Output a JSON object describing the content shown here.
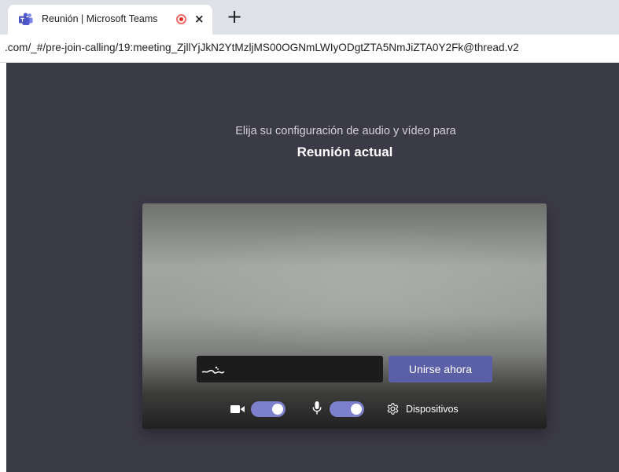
{
  "browser": {
    "tab": {
      "title": "Reunión | Microsoft Teams",
      "close_glyph": "×",
      "icon": "teams-icon",
      "recording_icon": "recording-icon"
    },
    "new_tab_glyph": "+",
    "address_bar": {
      "url": ".com/_#/pre-join-calling/19:meeting_ZjllYjJkN2YtMzljMS00OGNmLWIyODgtZTA5NmJiZTA0Y2Fk@thread.v2"
    }
  },
  "prejoin": {
    "subtitle": "Elija su configuración de audio y vídeo para",
    "meeting_title": "Reunión actual",
    "name_input": {
      "value": ""
    },
    "join_label": "Unirse ahora",
    "camera": {
      "icon": "camera-icon",
      "enabled": true
    },
    "microphone": {
      "icon": "microphone-icon",
      "enabled": true
    },
    "devices_label": "Dispositivos",
    "devices_icon": "gear-icon"
  },
  "colors": {
    "page_background": "#3b3a47",
    "accent": "#5b5fa6",
    "toggle_on": "#7d80cc"
  }
}
